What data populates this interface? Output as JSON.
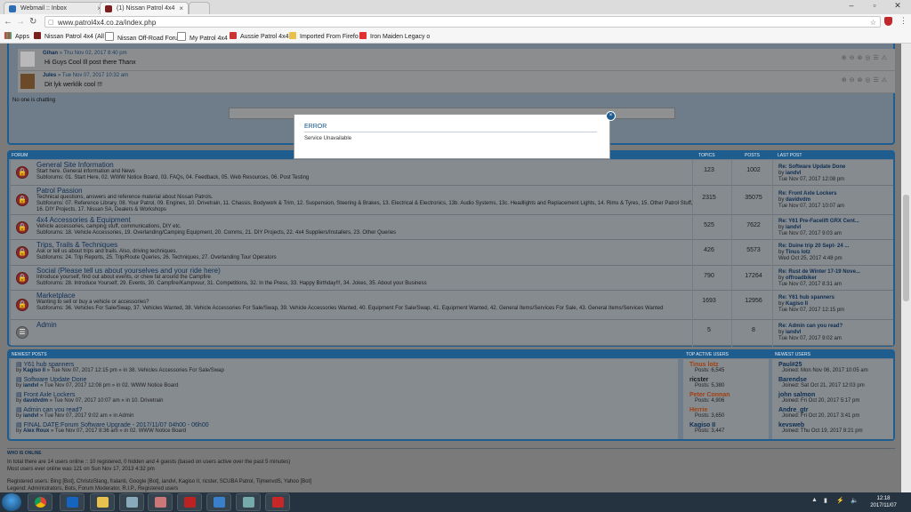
{
  "browser": {
    "tabs": [
      {
        "label": "Webmail :: Inbox",
        "active": false
      },
      {
        "label": "(1) Nissan Patrol 4x4",
        "active": true
      }
    ],
    "url": "www.patrol4x4.co.za/index.php",
    "bookmarks": [
      "Apps",
      "Nissan Patrol 4x4 (All",
      "Nissan Off-Road Foru",
      "My Patrol 4x4",
      "Aussie Patrol 4x4",
      "Imported From Firefo",
      "Iron Maiden Legacy o"
    ]
  },
  "chat": {
    "messages": [
      {
        "user": "Gihan",
        "time": "» Thu Nov 02, 2017 8:40 pm",
        "text": "Hi Guys Cool Ill post there Thanx"
      },
      {
        "user": "Jules",
        "time": "» Tue Nov 07, 2017 10:32 am",
        "text": "Dit lyk werklik cool !!!"
      }
    ],
    "status": "No one is chatting"
  },
  "forum_header": {
    "forum": "FORUM",
    "topics": "TOPICS",
    "posts": "POSTS",
    "last_post": "LAST POST"
  },
  "forums": [
    {
      "title": "General Site Information",
      "desc": "Start here. General information and News",
      "subforums": "Subforums: 01. Start Here, 02. WWW Notice Board, 03. FAQs, 04. Feedback, 05. Web Resources, 06. Post Testing",
      "topics": "123",
      "posts": "1002",
      "lp_title": "Re: Software Update Done",
      "lp_by": "by",
      "lp_user": "iandvl",
      "lp_date": "Tue Nov 07, 2017 12:08 pm"
    },
    {
      "title": "Patrol Passion",
      "desc": "Technical questions, answers and reference material about Nissan Patrols.",
      "subforums": "Subforums: 07. Reference Library, 08. Your Patrol, 09. Engines, 10. Drivetrain, 11. Chassis, Bodywork & Trim, 12. Suspension, Steering & Brakes, 13. Electrical & Electronics, 13b. Audio Systems, 13c. Headlights and Replacement Lights, 14. Rims & Tyres, 15. Other Patrol Stuff, 16. DIY Projects, 17. Nissan SA, Dealers & Workshops",
      "topics": "2315",
      "posts": "35075",
      "lp_title": "Re: Front Axle Lockers",
      "lp_by": "by",
      "lp_user": "davidvdm",
      "lp_date": "Tue Nov 07, 2017 10:07 am"
    },
    {
      "title": "4x4 Accessories & Equipment",
      "desc": "Vehicle accessories, camping stuff, communications, DIY etc.",
      "subforums": "Subforums: 18. Vehicle Accessories, 19. Overlanding/Camping Equipment, 20. Comms, 21. DIY Projects, 22. 4x4 Suppliers/Installers, 23. Other Queries",
      "topics": "525",
      "posts": "7622",
      "lp_title": "Re: Y61 Pre-Facelift GRX Cent...",
      "lp_by": "by",
      "lp_user": "iandvl",
      "lp_date": "Tue Nov 07, 2017 9:03 am"
    },
    {
      "title": "Trips, Trails & Techniques",
      "desc": "Ask or tell us about trips and trails. Also, driving techniques.",
      "subforums": "Subforums: 24. Trip Reports, 25. Trip/Route Queries, 26. Techniques, 27. Overlanding Tour Operators",
      "topics": "426",
      "posts": "5573",
      "lp_title": "Re: Duine trip 20 Sept- 24 ...",
      "lp_by": "by",
      "lp_user": "Tinus lotz",
      "lp_date": "Wed Oct 25, 2017 4:48 pm"
    },
    {
      "title": "Social (Please tell us about yourselves and your ride here)",
      "desc": "Introduce yourself, find out about events, or chew fat around the Campfire",
      "subforums": "Subforums: 28. Introduce Yourself, 29. Events, 30. Campfire/Kampvuur, 31. Competitions, 32. In the Press, 33. Happy Birthday!!!, 34. Jokes, 35. About your Business",
      "topics": "790",
      "posts": "17264",
      "lp_title": "Re: Rust de Winter 17-19 Nove...",
      "lp_by": "by",
      "lp_user": "offroadbiker",
      "lp_date": "Tue Nov 07, 2017 8:31 am"
    },
    {
      "title": "Marketplace",
      "desc": "Wanting to sell or buy a vehicle or accessories?",
      "subforums": "Subforums: 36. Vehicles For Sale/Swap, 37. Vehicles Wanted, 38. Vehicle Accessories For Sale/Swap, 39. Vehicle Accessories Wanted, 40. Equipment For Sale/Swap, 41. Equipment Wanted, 42. General Items/Services For Sale, 43. General Items/Services Wanted",
      "topics": "1693",
      "posts": "12956",
      "lp_title": "Re: Y61 hub spanners",
      "lp_by": "by",
      "lp_user": "Kagiso II",
      "lp_date": "Tue Nov 07, 2017 12:15 pm"
    },
    {
      "title": "Admin",
      "desc": "",
      "subforums": "",
      "topics": "5",
      "posts": "8",
      "lp_title": "Re: Admin can you read?",
      "lp_by": "by",
      "lp_user": "iandvl",
      "lp_date": "Tue Nov 07, 2017 9:02 am"
    }
  ],
  "newest_header": {
    "posts": "NEWEST POSTS",
    "top": "TOP ACTIVE USERS",
    "newest": "NEWEST USERS"
  },
  "newest_posts": [
    {
      "title": "Y61 hub spanners",
      "user": "Kagiso II",
      "meta": "» Tue Nov 07, 2017 12:15 pm » in 38. Vehicles Accessories For Sale/Swap"
    },
    {
      "title": "Software Update Done",
      "user": "iandvl",
      "meta": "» Tue Nov 07, 2017 12:08 pm » in 02. WWW Notice Board"
    },
    {
      "title": "Front Axle Lockers",
      "user": "davidvdm",
      "meta": "» Tue Nov 07, 2017 10:07 am » in 10. Drivetrain"
    },
    {
      "title": "Admin can you read?",
      "user": "iandvl",
      "meta": "» Tue Nov 07, 2017 9:02 am » in Admin"
    },
    {
      "title": "FINAL DATE:Forum Software Upgrade - 2017/11/07 04h00 - 06h00",
      "user": "Alex Roux",
      "meta": "» Tue Nov 07, 2017 8:36 am » in 02. WWW Notice Board"
    }
  ],
  "top_users": [
    {
      "name": "Tinus lotz",
      "posts": "Posts: 6,545",
      "color": "#a04010"
    },
    {
      "name": "ricster",
      "posts": "Posts: 5,380",
      "color": "#1a1a1a"
    },
    {
      "name": "Peter Connan",
      "posts": "Posts: 4,906",
      "color": "#a04010"
    },
    {
      "name": "Herrie",
      "posts": "Posts: 3,650",
      "color": "#a04010"
    },
    {
      "name": "Kagiso II",
      "posts": "Posts: 3,447",
      "color": "#0d2d50"
    }
  ],
  "newest_users": [
    {
      "name": "Paul#25",
      "joined": "Joined: Mon Nov 06, 2017 10:05 am"
    },
    {
      "name": "Barendse",
      "joined": "Joined: Sat Oct 21, 2017 12:03 pm"
    },
    {
      "name": "john salmon",
      "joined": "Joined: Fri Oct 20, 2017 5:17 pm"
    },
    {
      "name": "Andre_gtr",
      "joined": "Joined: Fri Oct 20, 2017 3:41 pm"
    },
    {
      "name": "kevsweb",
      "joined": "Joined: Thu Oct 19, 2017 8:21 pm"
    }
  ],
  "who": {
    "title": "WHO IS ONLINE",
    "line1": "In total there are 14 users online :: 10 registered, 0 hidden and 4 guests (based on users active over the past 5 minutes)",
    "line2": "Most users ever online was 121 on Sun Nov 17, 2013 4:32 pm",
    "line3": "Registered users: Bing [Bot], ChristoSlang, fralanti, Google [Bot], iandvl, Kagiso II, ricster, SCUBA Patrol, TijmenvdS, Yahoo [Bot]",
    "line4": "Legend: Administrators, Bots, Forum Moderator, R.I.P., Registered users"
  },
  "modal": {
    "title": "ERROR",
    "message": "Service Unavailable",
    "close": "×"
  },
  "clock": {
    "time": "12:18",
    "date": "2017/11/07"
  }
}
